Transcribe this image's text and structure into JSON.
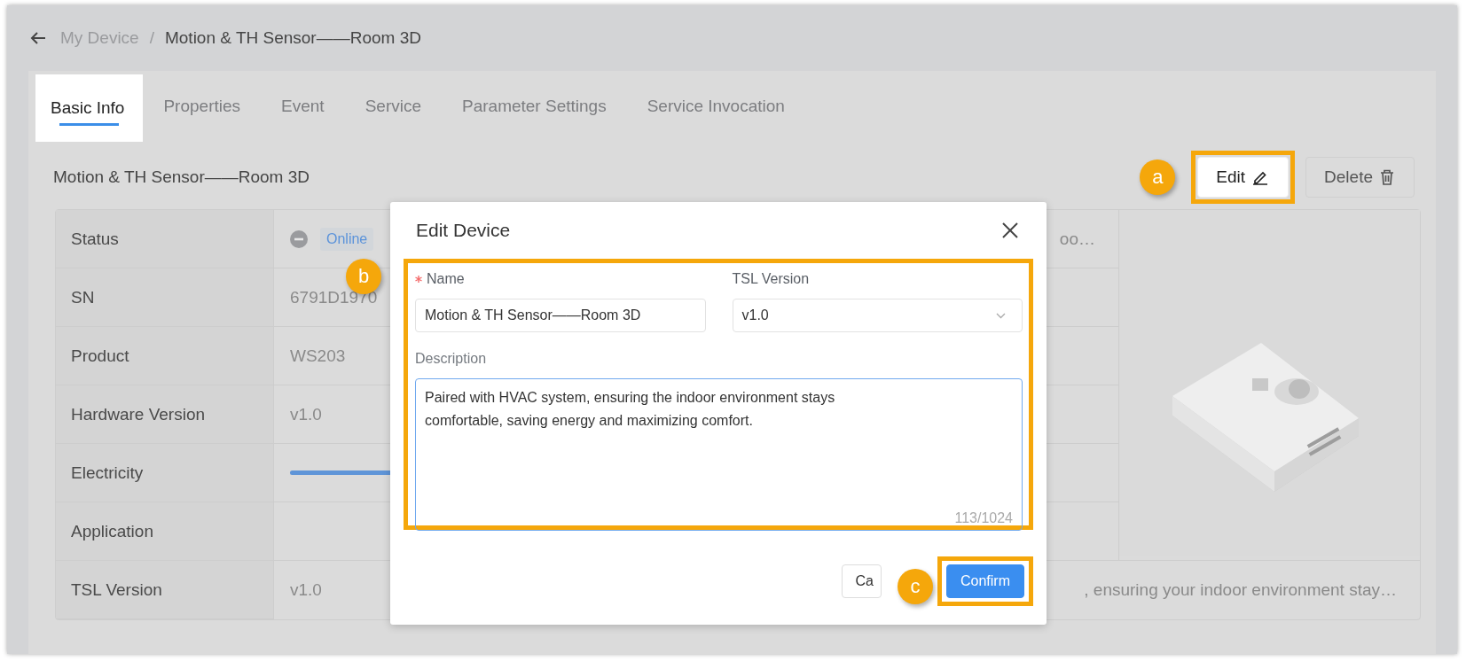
{
  "breadcrumb": {
    "parent": "My Device",
    "separator": "/",
    "current": "Motion & TH Sensor——Room 3D"
  },
  "tabs": [
    {
      "label": "Basic Info",
      "selected": true
    },
    {
      "label": "Properties",
      "selected": false
    },
    {
      "label": "Event",
      "selected": false
    },
    {
      "label": "Service",
      "selected": false
    },
    {
      "label": "Parameter Settings",
      "selected": false
    },
    {
      "label": "Service Invocation",
      "selected": false
    }
  ],
  "device_title": "Motion & TH Sensor——Room 3D",
  "actions": [
    {
      "kind": "edit",
      "label": "Edit",
      "annotated": true,
      "callout": "a"
    },
    {
      "kind": "delete",
      "label": "Delete",
      "annotated": false
    }
  ],
  "details": {
    "rows": [
      {
        "kind": "status",
        "label": "Status",
        "value": "Online",
        "trailing": "oo…"
      },
      {
        "kind": "text",
        "label": "SN",
        "value": "6791D1970"
      },
      {
        "kind": "text",
        "label": "Product",
        "value": "WS203"
      },
      {
        "kind": "text",
        "label": "Hardware Version",
        "value": "v1.0"
      },
      {
        "kind": "meter",
        "label": "Electricity",
        "level": 1
      },
      {
        "kind": "text",
        "label": "Application"
      },
      {
        "kind": "text",
        "label": "TSL Version",
        "value": "v1.0",
        "trailing": ", ensuring your indoor environment stay…"
      }
    ]
  },
  "modal": {
    "title": "Edit Device",
    "form": {
      "annotated": true,
      "callout": "b",
      "name": {
        "label": "Name",
        "required": true,
        "value": "Motion & TH Sensor——Room 3D"
      },
      "tsl_version": {
        "label": "TSL Version",
        "value": "v1.0"
      },
      "description": {
        "label": "Description",
        "value": "Paired with HVAC system, ensuring the indoor environment stays\ncomfortable, saving energy and maximizing comfort.",
        "counter": "113/1024"
      }
    },
    "buttons": [
      {
        "kind": "cancel",
        "label": "Ca",
        "annotated": false
      },
      {
        "kind": "confirm",
        "label": "Confirm",
        "annotated": true,
        "callout": "c"
      }
    ]
  }
}
